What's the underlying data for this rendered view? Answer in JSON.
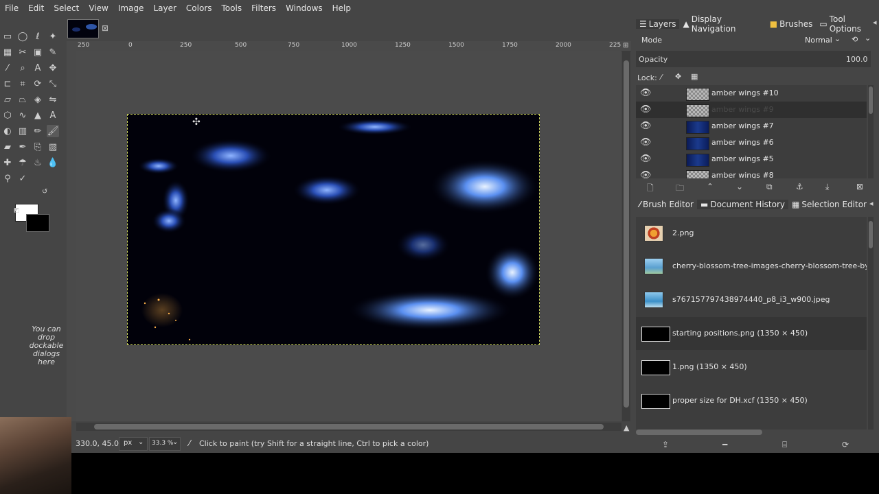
{
  "menubar": [
    "File",
    "Edit",
    "Select",
    "View",
    "Image",
    "Layer",
    "Colors",
    "Tools",
    "Filters",
    "Windows",
    "Help"
  ],
  "toolbox": {
    "tools": [
      "rect-select",
      "ellipse-select",
      "free-select",
      "fuzzy-select",
      "select-by-color",
      "scissors",
      "foreground-select",
      "paths",
      "color-picker",
      "zoom",
      "measure",
      "text",
      "align",
      "crop",
      "rotate",
      "scale",
      "shear",
      "perspective",
      "3d-transform",
      "flip",
      "cage",
      "warp",
      "unified-transform",
      "handle-transform",
      "bucket-fill",
      "blend",
      "pencil",
      "paintbrush",
      "eraser",
      "airbrush",
      "ink",
      "mypaint-brush",
      "clone",
      "heal",
      "perspective-clone",
      "blur",
      "smudge",
      "dodge-burn"
    ],
    "drop_hint": "You can drop dockable dialogs here"
  },
  "ruler": {
    "ticks": [
      "250",
      "0",
      "250",
      "500",
      "750",
      "1000",
      "1250",
      "1500",
      "1750",
      "2000",
      "225"
    ]
  },
  "status": {
    "coords": "330.0, 45.0",
    "unit": "px",
    "zoom": "33.3 %",
    "message": "Click to paint (try Shift for a straight line, Ctrl to pick a color)"
  },
  "dock": {
    "top_tabs": [
      "Layers",
      "Display Navigation",
      "Brushes",
      "Tool Options"
    ],
    "mode_label": "Mode",
    "mode_value": "Normal",
    "opacity_label": "Opacity",
    "opacity_value": "100.0",
    "lock_label": "Lock:",
    "layers": [
      {
        "name": "amber wings #10",
        "thumb": "check"
      },
      {
        "name": "amber wings #9",
        "thumb": "check"
      },
      {
        "name": "amber wings #7",
        "thumb": "blue"
      },
      {
        "name": "amber wings #6",
        "thumb": "blue"
      },
      {
        "name": "amber wings #5",
        "thumb": "blue"
      },
      {
        "name": "amber wings #8",
        "thumb": "check"
      }
    ],
    "bottom_tabs": [
      "Brush Editor",
      "Document History",
      "Selection Editor"
    ],
    "history": [
      "2.png",
      "cherry-blossom-tree-images-cherry-blossom-tree-by-",
      "s767157797438974440_p8_i3_w900.jpeg",
      "starting positions.png (1350 × 450)",
      "1.png (1350 × 450)",
      "proper size for DH.xcf (1350 × 450)"
    ]
  },
  "colors": {
    "accent": "#cbd45a",
    "panel": "#454545",
    "list": "#3d3d3d"
  }
}
